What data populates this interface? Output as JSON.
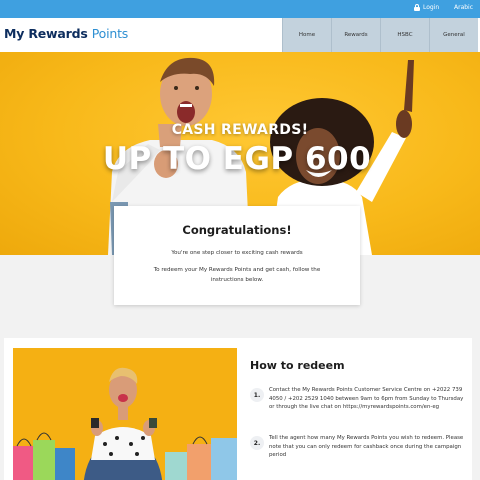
{
  "topbar": {
    "login": "Login",
    "language": "Arabic"
  },
  "header": {
    "logo_part1": "My Rewards",
    "logo_part2": "Points",
    "nav": [
      "Home",
      "Rewards",
      "HSBC",
      "General"
    ]
  },
  "hero": {
    "subtitle": "CASH REWARDS!",
    "title": "UP TO EGP 600"
  },
  "card": {
    "title": "Congratulations!",
    "line1": "You're one step closer to exciting cash rewards",
    "line2": "To redeem your My Rewards Points and get cash, follow the instructions below."
  },
  "redeem": {
    "title": "How to redeem",
    "steps": [
      {
        "num": "1.",
        "text": "Contact the My Rewards Points Customer Service Centre on +2022 739 4050 / +202 2529 1040 between 9am to 6pm from Sunday to Thursday or through the live chat on https://myrewardspoints.com/en-eg"
      },
      {
        "num": "2.",
        "text": "Tell the agent how many My Rewards Points you wish to redeem. Please note that you can only redeem for cashback once during the campaign period"
      }
    ]
  },
  "colors": {
    "topbar": "#3fa0e0",
    "hero_yellow": "#f8b91a",
    "logo_navy": "#0d2d5e",
    "logo_blue": "#2e8fd2",
    "nav_bg": "#c3d2dd"
  }
}
